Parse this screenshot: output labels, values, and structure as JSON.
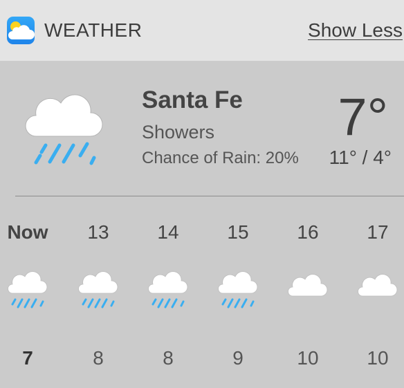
{
  "header": {
    "app_name": "WEATHER",
    "show_less_label": "Show Less",
    "app_icon": "weather-app-icon"
  },
  "current": {
    "city": "Santa Fe",
    "condition": "Showers",
    "rain_chance": "Chance of Rain: 20%",
    "temperature": "7°",
    "range": "11° / 4°",
    "icon": "rain-cloud-icon"
  },
  "forecast": [
    {
      "label": "Now",
      "value": "7",
      "icon": "rain-cloud-icon"
    },
    {
      "label": "13",
      "value": "8",
      "icon": "rain-cloud-icon"
    },
    {
      "label": "14",
      "value": "8",
      "icon": "rain-cloud-icon"
    },
    {
      "label": "15",
      "value": "9",
      "icon": "rain-cloud-icon"
    },
    {
      "label": "16",
      "value": "10",
      "icon": "cloud-icon"
    },
    {
      "label": "17",
      "value": "10",
      "icon": "cloud-icon"
    }
  ],
  "colors": {
    "header_bg": "#e4e4e4",
    "body_bg": "#cbcbcb",
    "rain": "#3aaef0",
    "cloud": "#ffffff",
    "app_icon": "#1e84ea",
    "sun": "#ffd21f"
  }
}
